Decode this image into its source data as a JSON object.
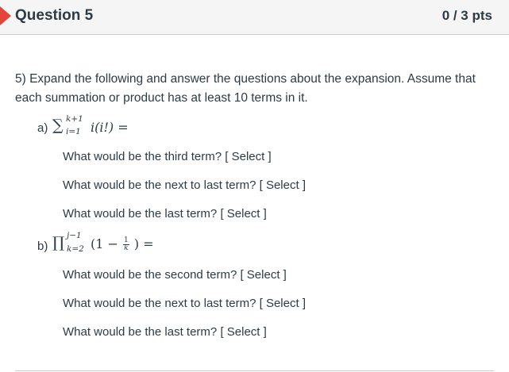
{
  "question": {
    "title": "Question 5",
    "points": "0 / 3 pts"
  },
  "prompt": "5) Expand the following and answer the questions about the expansion.  Assume that each summation or product has at least 10 terms in it.",
  "part_a": {
    "label": "a)",
    "operator": "∑",
    "upper": "k+1",
    "lower": "i=1",
    "expression": "i(i!) =",
    "questions": [
      {
        "text": "What would be the third term? ",
        "select": "[ Select ]"
      },
      {
        "text": "What would be the next to last term? ",
        "select": "[ Select ]"
      },
      {
        "text": "What would be the last term? ",
        "select": "[ Select ]"
      }
    ]
  },
  "part_b": {
    "label": "b)",
    "operator": "∏",
    "upper": "j−1",
    "lower": "k=2",
    "expr_open": "(1 −",
    "frac_num": "1",
    "frac_den": "k",
    "expr_close": ") =",
    "questions": [
      {
        "text": "What would be the second term? ",
        "select": "[ Select ]"
      },
      {
        "text": "What would be the next to last term? ",
        "select": "[ Select ]"
      },
      {
        "text": "What would be the last term? ",
        "select": "[ Select ]"
      }
    ]
  }
}
